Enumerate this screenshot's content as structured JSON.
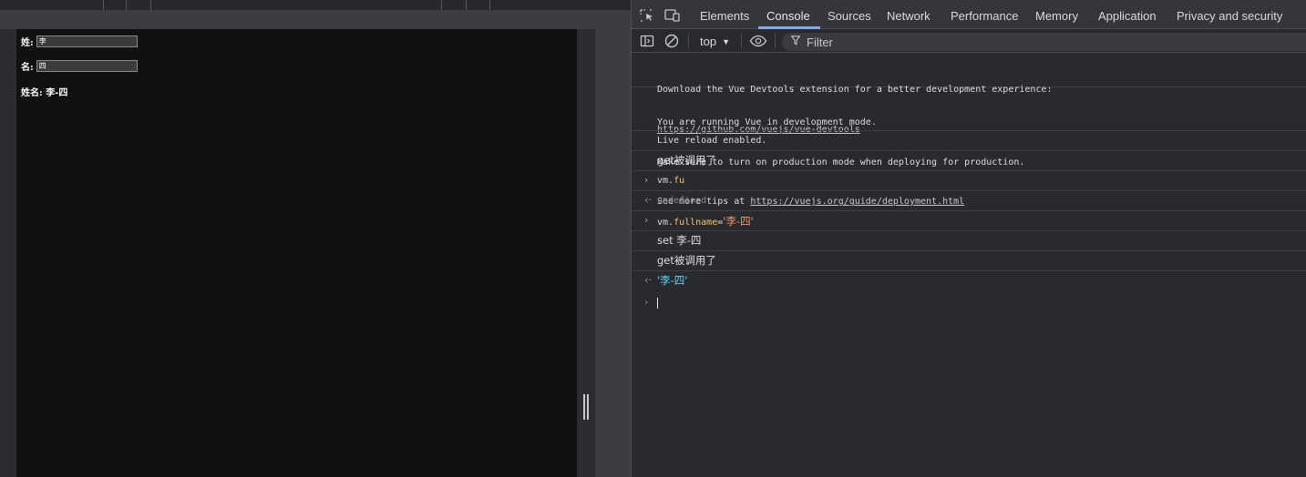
{
  "page": {
    "surname_label": "姓:",
    "surname_value": "李",
    "given_label": "名:",
    "given_value": "四",
    "fullname_label": "姓名:",
    "fullname_value": "李-四"
  },
  "devtools": {
    "tabs": [
      "Elements",
      "Console",
      "Sources",
      "Network",
      "Performance",
      "Memory",
      "Application",
      "Privacy and security"
    ],
    "active_tab": "Console",
    "context": "top",
    "filter_placeholder": "Filter"
  },
  "console": {
    "msg1_line1": "Download the Vue Devtools extension for a better development experience:",
    "msg1_link": "https://github.com/vuejs/vue-devtools",
    "msg2_line1": "You are running Vue in development mode.",
    "msg2_line2": "Make sure to turn on production mode when deploying for production.",
    "msg2_line3_prefix": "See more tips at ",
    "msg2_link": "https://vuejs.org/guide/deployment.html",
    "msg3": "Live reload enabled.",
    "msg4": "get被调用了",
    "cmd1_obj": "vm.",
    "cmd1_prop": "fu",
    "result1": "undefined",
    "cmd2_obj": "vm.",
    "cmd2_prop": "fullname",
    "cmd2_eq": "=",
    "cmd2_str": "'李-四'",
    "msg5": "set 李-四",
    "msg6": "get被调用了",
    "result2": "'李-四'"
  },
  "colors": {
    "accent_tab": "#7cacf8",
    "property": "#f0c674",
    "string_orange": "#f29766",
    "string_cyan": "#5cd5fb"
  }
}
